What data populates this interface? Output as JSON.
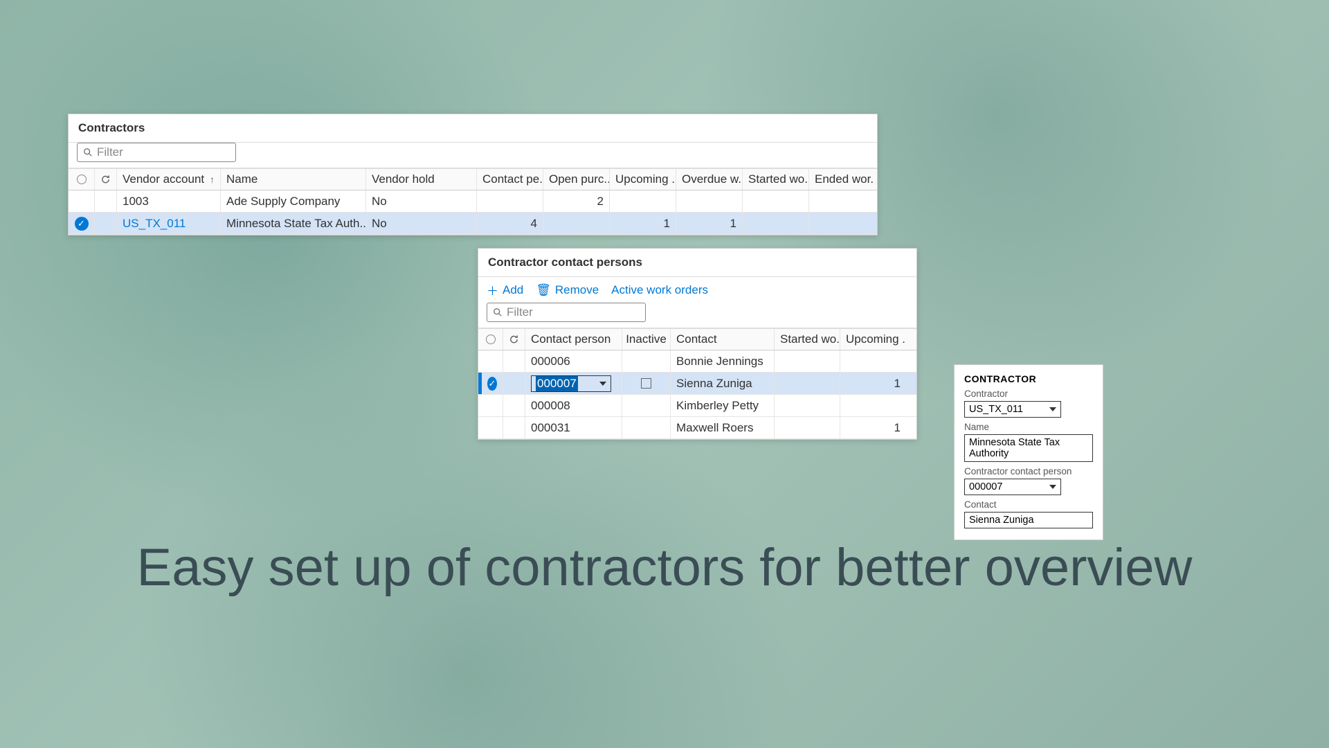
{
  "tagline": "Easy set up of contractors for better overview",
  "contractors": {
    "title": "Contractors",
    "filter_placeholder": "Filter",
    "columns": {
      "vendor_account": "Vendor account",
      "name": "Name",
      "vendor_hold": "Vendor hold",
      "contact_pe": "Contact pe...",
      "open_purc": "Open purc...",
      "upcoming": "Upcoming ...",
      "overdue": "Overdue w...",
      "started": "Started wo...",
      "ended": "Ended wor..."
    },
    "rows": [
      {
        "selected": false,
        "vendor_account": "1003",
        "name": "Ade Supply Company",
        "vendor_hold": "No",
        "contact_pe": "",
        "open_purc": "2",
        "upcoming": "",
        "overdue": "",
        "started": "",
        "ended": "",
        "link": false
      },
      {
        "selected": true,
        "vendor_account": "US_TX_011",
        "name": "Minnesota State Tax Auth...",
        "vendor_hold": "No",
        "contact_pe": "4",
        "open_purc": "",
        "upcoming": "1",
        "overdue": "1",
        "started": "",
        "ended": "",
        "link": true
      }
    ]
  },
  "contacts": {
    "title": "Contractor contact persons",
    "actions": {
      "add": "Add",
      "remove": "Remove",
      "active_wo": "Active work orders"
    },
    "filter_placeholder": "Filter",
    "columns": {
      "contact_person": "Contact person",
      "inactive": "Inactive",
      "contact": "Contact",
      "started": "Started wo...",
      "upcoming": "Upcoming ..."
    },
    "rows": [
      {
        "selected": false,
        "contact_person": "000006",
        "inactive": "",
        "contact": "Bonnie Jennings",
        "started": "",
        "upcoming": "",
        "edit": false
      },
      {
        "selected": true,
        "contact_person": "000007",
        "inactive": "☐",
        "contact": "Sienna Zuniga",
        "started": "",
        "upcoming": "1",
        "edit": true
      },
      {
        "selected": false,
        "contact_person": "000008",
        "inactive": "",
        "contact": "Kimberley Petty",
        "started": "",
        "upcoming": "",
        "edit": false
      },
      {
        "selected": false,
        "contact_person": "000031",
        "inactive": "",
        "contact": "Maxwell Roers",
        "started": "",
        "upcoming": "1",
        "edit": false
      }
    ]
  },
  "card": {
    "heading": "CONTRACTOR",
    "contractor_label": "Contractor",
    "contractor_value": "US_TX_011",
    "name_label": "Name",
    "name_value": "Minnesota State Tax Authority",
    "ccp_label": "Contractor contact person",
    "ccp_value": "000007",
    "contact_label": "Contact",
    "contact_value": "Sienna Zuniga"
  }
}
